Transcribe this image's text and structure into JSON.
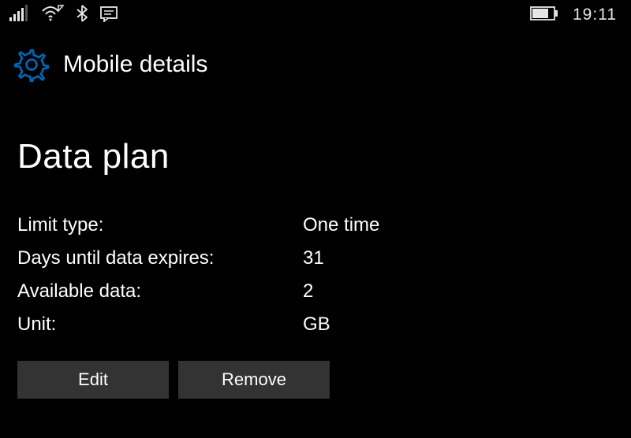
{
  "statusbar": {
    "time": "19:11"
  },
  "header": {
    "title": "Mobile details"
  },
  "main": {
    "heading": "Data plan",
    "rows": [
      {
        "label": "Limit type:",
        "value": "One time"
      },
      {
        "label": "Days until data expires:",
        "value": "31"
      },
      {
        "label": "Available data:",
        "value": "2"
      },
      {
        "label": "Unit:",
        "value": "GB"
      }
    ],
    "buttons": {
      "edit": "Edit",
      "remove": "Remove"
    }
  }
}
